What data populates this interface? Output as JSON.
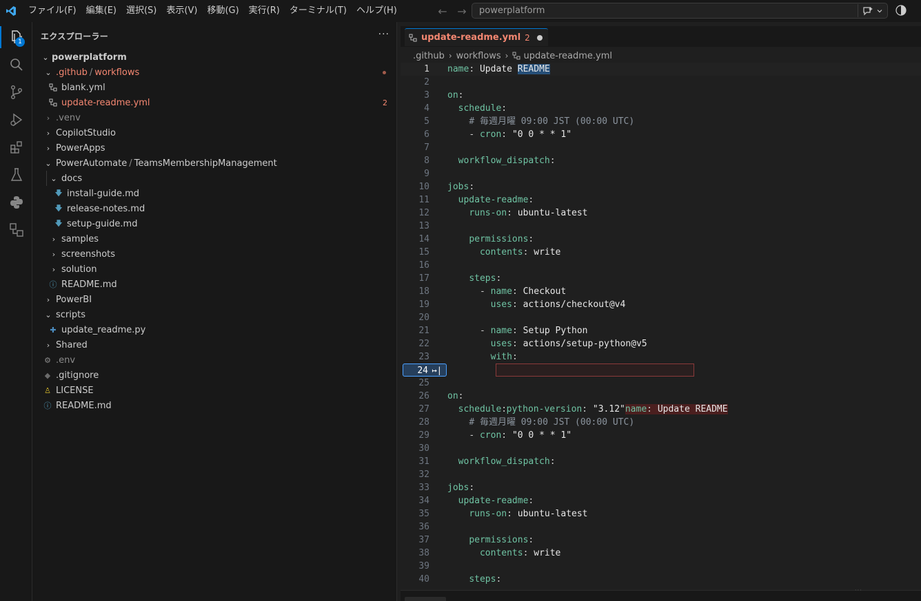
{
  "menu": [
    "ファイル(F)",
    "編集(E)",
    "選択(S)",
    "表示(V)",
    "移動(G)",
    "実行(R)",
    "ターミナル(T)",
    "ヘルプ(H)"
  ],
  "search": {
    "text": "powerplatform"
  },
  "activity": {
    "explorer_badge": "1"
  },
  "sidebar": {
    "title": "エクスプローラー",
    "more": "···",
    "root": "powerplatform",
    "items": {
      "github_a": ".github",
      "github_sep": "/",
      "github_b": "workflows",
      "blank": "blank.yml",
      "update_readme": "update-readme.yml",
      "update_readme_badge": "2",
      "venv": ".venv",
      "copilot": "CopilotStudio",
      "powerapps": "PowerApps",
      "pa_a": "PowerAutomate",
      "pa_sep": "/",
      "pa_b": "TeamsMembershipManagement",
      "docs": "docs",
      "install": "install-guide.md",
      "release": "release-notes.md",
      "setup": "setup-guide.md",
      "samples": "samples",
      "screenshots": "screenshots",
      "solution": "solution",
      "readme_inner": "README.md",
      "powerbi": "PowerBI",
      "scripts": "scripts",
      "update_py": "update_readme.py",
      "shared": "Shared",
      "env": ".env",
      "gitignore": ".gitignore",
      "license": "LICENSE",
      "readme_root": "README.md"
    }
  },
  "editor": {
    "tab": {
      "label": "update-readme.yml",
      "count": "2"
    },
    "breadcrumb": [
      ".github",
      "workflows",
      "update-readme.yml"
    ],
    "lines": [
      {
        "n": "1"
      },
      {
        "n": "2"
      },
      {
        "n": "3"
      },
      {
        "n": "4"
      },
      {
        "n": "5"
      },
      {
        "n": "6"
      },
      {
        "n": "7"
      },
      {
        "n": "8"
      },
      {
        "n": "9"
      },
      {
        "n": "10"
      },
      {
        "n": "11"
      },
      {
        "n": "12"
      },
      {
        "n": "13"
      },
      {
        "n": "14"
      },
      {
        "n": "15"
      },
      {
        "n": "16"
      },
      {
        "n": "17"
      },
      {
        "n": "18"
      },
      {
        "n": "19"
      },
      {
        "n": "20"
      },
      {
        "n": "21"
      },
      {
        "n": "22"
      },
      {
        "n": "23"
      },
      {
        "n": "24"
      },
      {
        "n": "25"
      },
      {
        "n": "26"
      },
      {
        "n": "27"
      },
      {
        "n": "28"
      },
      {
        "n": "29"
      },
      {
        "n": "30"
      },
      {
        "n": "31"
      },
      {
        "n": "32"
      },
      {
        "n": "33"
      },
      {
        "n": "34"
      },
      {
        "n": "35"
      },
      {
        "n": "36"
      },
      {
        "n": "37"
      },
      {
        "n": "38"
      },
      {
        "n": "39"
      },
      {
        "n": "40"
      }
    ],
    "tokens": {
      "name_key": "name",
      "colon": ":",
      "update_readme": "Update",
      "readme_word": "README",
      "on": "on",
      "schedule": "schedule",
      "comment": "# 毎週月曜 09:00 JST (00:00 UTC)",
      "dash": "-",
      "cron": "cron",
      "cron_val": "\"0 0 * * 1\"",
      "dispatch": "workflow_dispatch",
      "jobs": "jobs",
      "job_name": "update-readme",
      "runs_on": "runs-on",
      "ubuntu": "ubuntu-latest",
      "permissions": "permissions",
      "contents": "contents",
      "write": "write",
      "steps": "steps",
      "checkout": "Checkout",
      "uses": "uses",
      "checkout_v": "actions/checkout@v4",
      "setup_python": "Setup Python",
      "setup_v": "actions/setup-python@v5",
      "with": "with",
      "py_version": "python-version",
      "py_val": "\"3.12\"",
      "inline_name": "name",
      "inline_val": "Update README"
    }
  }
}
